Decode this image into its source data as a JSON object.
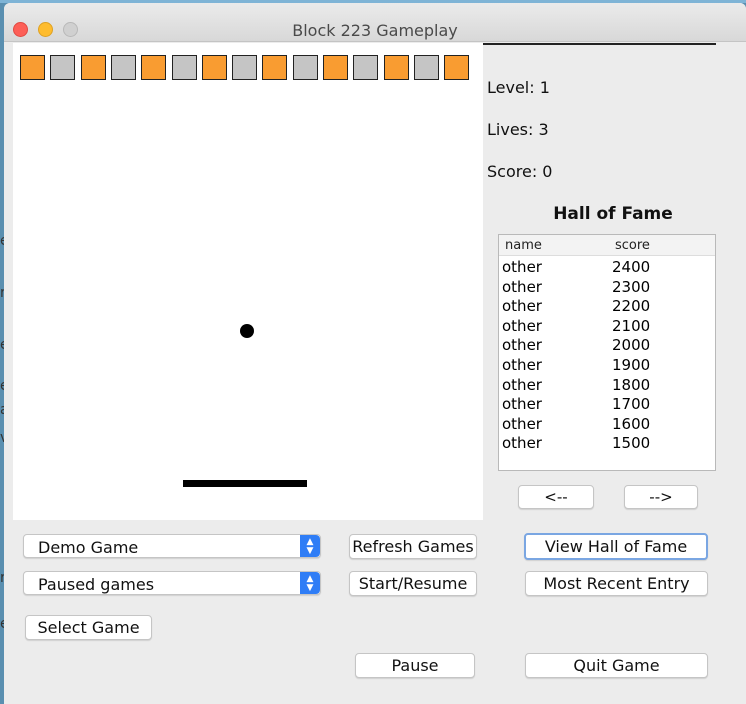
{
  "window": {
    "title": "Block 223 Gameplay"
  },
  "game": {
    "block_colors": [
      "#f99c31",
      "#c5c5c5",
      "#f99c31",
      "#c5c5c5",
      "#f99c31",
      "#c5c5c5",
      "#f99c31",
      "#c5c5c5",
      "#f99c31",
      "#c5c5c5",
      "#f99c31",
      "#c5c5c5",
      "#f99c31",
      "#c5c5c5",
      "#f99c31"
    ]
  },
  "stats": {
    "level": "Level: 1",
    "lives": "Lives: 3",
    "score": "Score: 0"
  },
  "hall_of_fame": {
    "title": "Hall of Fame",
    "columns": [
      "name",
      "score"
    ],
    "rows": [
      [
        "other",
        "2400"
      ],
      [
        "other",
        "2300"
      ],
      [
        "other",
        "2200"
      ],
      [
        "other",
        "2100"
      ],
      [
        "other",
        "2000"
      ],
      [
        "other",
        "1900"
      ],
      [
        "other",
        "1800"
      ],
      [
        "other",
        "1700"
      ],
      [
        "other",
        "1600"
      ],
      [
        "other",
        "1500"
      ]
    ],
    "prev_label": "<--",
    "next_label": "-->"
  },
  "controls": {
    "game_select": "Demo Game",
    "paused_select": "Paused games",
    "refresh_label": "Refresh Games",
    "start_label": "Start/Resume",
    "view_hof_label": "View Hall of Fame",
    "recent_label": "Most Recent Entry",
    "select_game_label": "Select Game",
    "pause_label": "Pause",
    "quit_label": "Quit Game"
  },
  "background_window_chars": [
    "e",
    "r",
    "e",
    "e",
    "a",
    "v",
    "r",
    "e"
  ]
}
